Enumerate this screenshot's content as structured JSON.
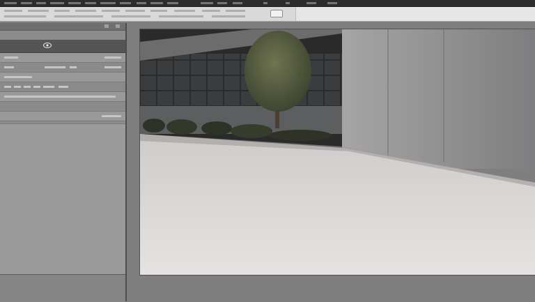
{
  "app": {
    "menubar_label": "",
    "toggle_state": "on"
  },
  "left_panel": {
    "header_title": "",
    "panel_title": "",
    "eye_icon": "eye-icon",
    "rows": [
      {
        "label": "",
        "value": ""
      },
      {
        "label": "",
        "value": ""
      },
      {
        "label": "",
        "value": ""
      },
      {
        "label": "",
        "value": ""
      },
      {
        "label": "",
        "value": ""
      }
    ]
  },
  "viewport": {
    "image_caption": ""
  },
  "colors": {
    "menubar": "#2c2c2e",
    "toolbar": "#d9d9d9",
    "panel": "#8d8d8d",
    "viewport": "#7f7f7f",
    "accent_title": "#a7c7d3"
  }
}
